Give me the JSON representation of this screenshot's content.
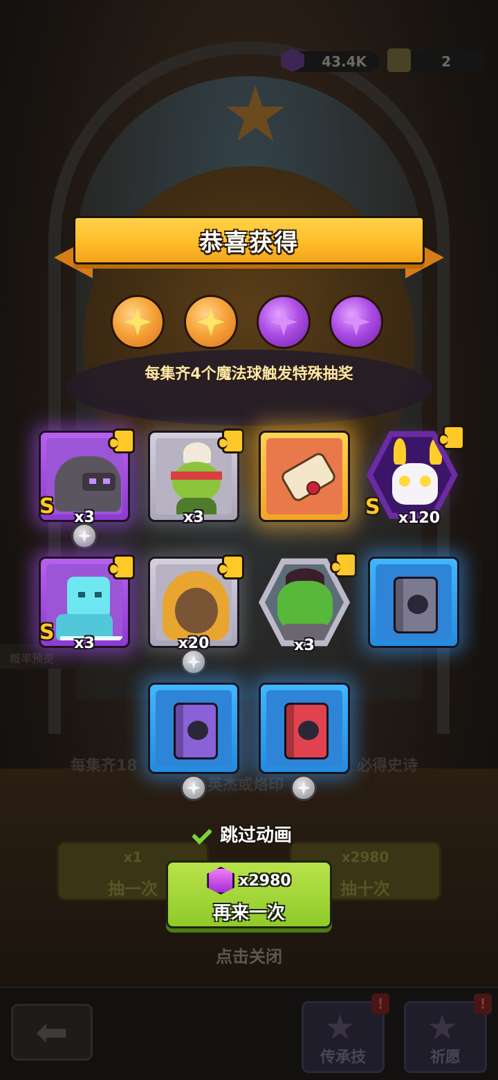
{
  "resources": {
    "gems": "43.4K",
    "tickets": "2"
  },
  "background": {
    "hint_text": "每集齐18",
    "hint_text_2": "必得史诗",
    "hint_text_3": "英杰或烙印",
    "odds_preview": "概率预览",
    "single_pull": {
      "count": "x1",
      "label": "抽一次"
    },
    "ten_pull": {
      "count": "x2980",
      "label": "抽十次"
    },
    "nav": [
      {
        "label": "传承技"
      },
      {
        "label": "祈愿"
      }
    ],
    "badge": "!"
  },
  "popup": {
    "title": "恭喜获得",
    "subtitle": "每集齐4个魔法球触发特殊抽奖",
    "orbs": [
      "gold",
      "gold",
      "purple",
      "purple"
    ],
    "rewards": [
      {
        "name": "stone-golem-hero",
        "rarity": "S",
        "qty": "x3",
        "frame": "purple",
        "shard": true
      },
      {
        "name": "goblin-chef-hero",
        "rarity": "",
        "qty": "x3",
        "frame": "gray",
        "shard": true
      },
      {
        "name": "scroll-item",
        "rarity": "",
        "qty": "",
        "frame": "gold",
        "shard": false
      },
      {
        "name": "skull-reaper-hero",
        "rarity": "S",
        "qty": "x120",
        "frame": "purple-hex",
        "shard": true
      },
      {
        "name": "ice-knight-hero",
        "rarity": "S",
        "qty": "x3",
        "frame": "purple",
        "shard": true
      },
      {
        "name": "hooded-monkey-hero",
        "rarity": "",
        "qty": "x20",
        "frame": "gray",
        "shard": true
      },
      {
        "name": "orc-warrior-hero",
        "rarity": "",
        "qty": "x3",
        "frame": "gray-hex",
        "shard": true
      },
      {
        "name": "skull-book",
        "rarity": "",
        "qty": "",
        "frame": "blue",
        "shard": false
      },
      {
        "name": "eye-book",
        "rarity": "",
        "qty": "",
        "frame": "blue",
        "shard": false
      },
      {
        "name": "wolf-book",
        "rarity": "",
        "qty": "",
        "frame": "blue",
        "shard": false
      }
    ],
    "skip_animation": {
      "label": "跳过动画",
      "checked": true
    },
    "again_button": {
      "cost": "x2980",
      "label": "再来一次"
    },
    "tap_to_close": "点击关闭"
  },
  "colors": {
    "banner": "#ffc02e",
    "button_green": "#9bd534",
    "purple_frame": "#a34ee0",
    "blue_frame": "#2f9bf0",
    "gold_frame": "#f7b93a"
  }
}
